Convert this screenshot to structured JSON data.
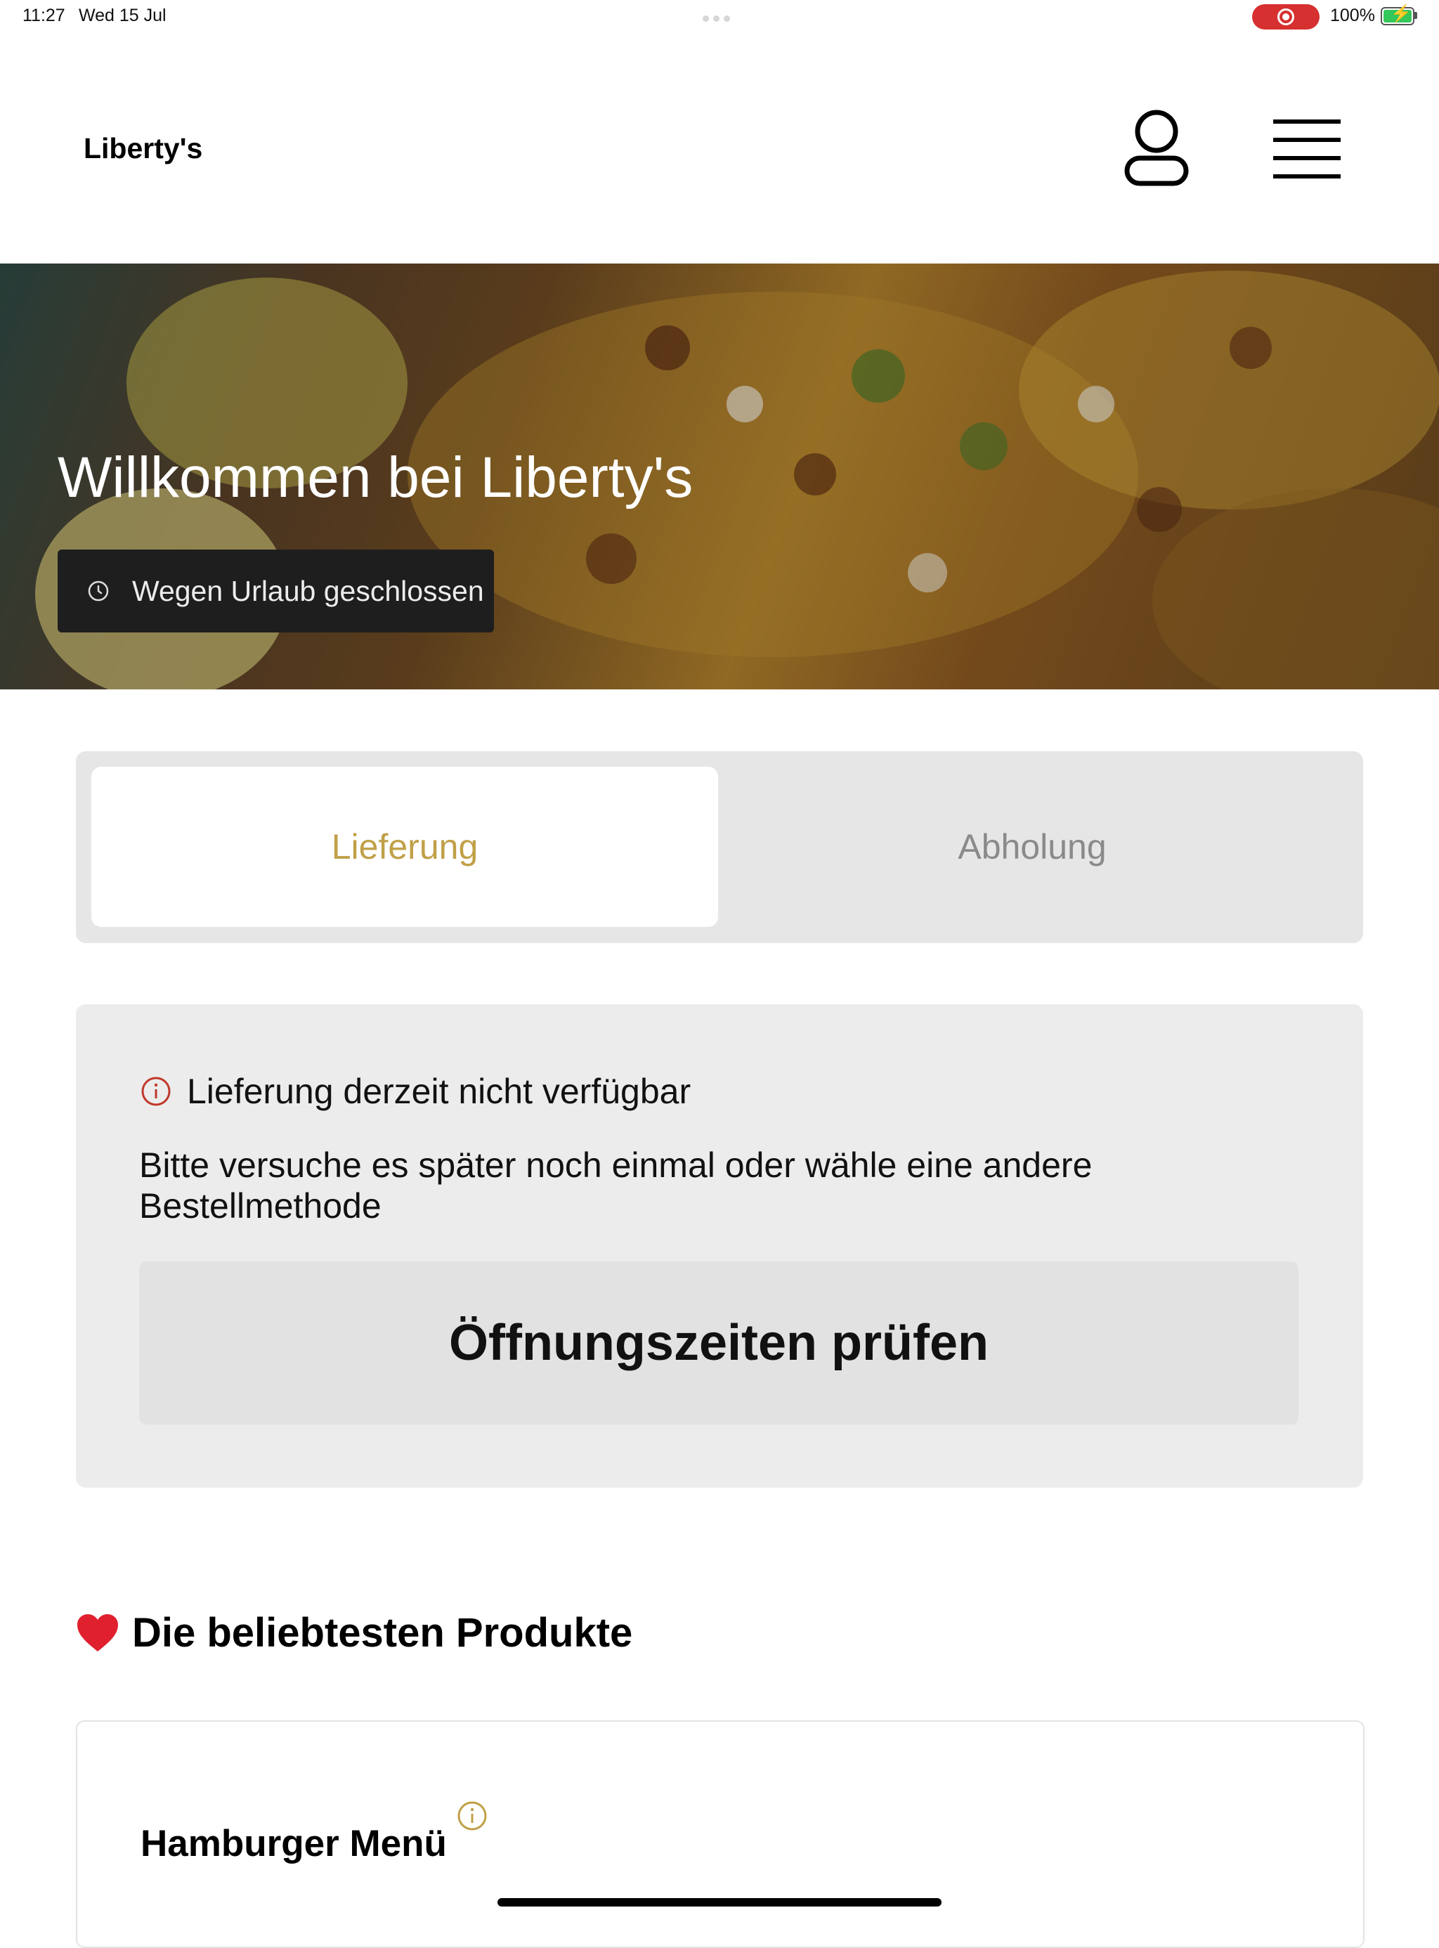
{
  "status_bar": {
    "time": "11:27",
    "date": "Wed 15 Jul",
    "battery_percent": "100%",
    "battery_level": 1.0,
    "recording_icon": "screen-record-icon",
    "charging": true
  },
  "header": {
    "brand": "Liberty's",
    "account_icon": "user-icon",
    "menu_icon": "hamburger-menu-icon"
  },
  "hero": {
    "title": "Willkommen bei Liberty's",
    "status_icon": "clock-icon",
    "status_text": "Wegen Urlaub geschlossen"
  },
  "order_method": {
    "tabs": [
      {
        "label": "Lieferung",
        "active": true
      },
      {
        "label": "Abholung",
        "active": false
      }
    ],
    "active_color": "#c0a048"
  },
  "notice": {
    "icon": "info-icon",
    "icon_color": "#c0392b",
    "title": "Lieferung derzeit nicht verfügbar",
    "message": "Bitte versuche es später noch einmal oder wähle eine andere Bestellmethode",
    "button_label": "Öffnungszeiten prüfen"
  },
  "products_section": {
    "icon": "heart-icon",
    "title": "Die beliebtesten Produkte",
    "items": [
      {
        "name": "Hamburger Menü",
        "info_icon": "info-icon"
      }
    ]
  }
}
